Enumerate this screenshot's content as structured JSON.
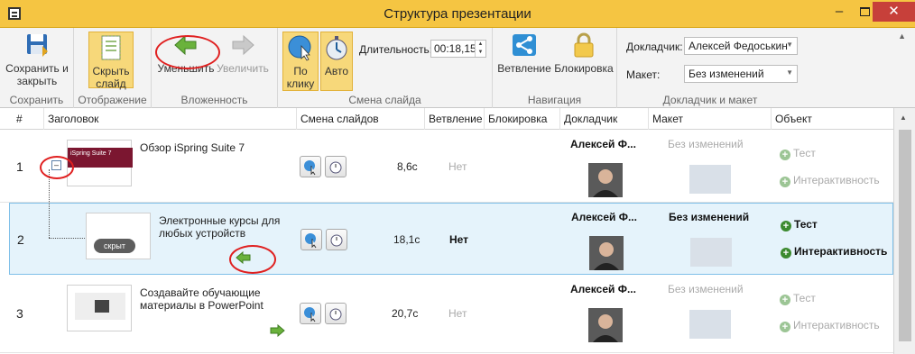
{
  "window": {
    "title": "Структура презентации",
    "min": "–",
    "max": "",
    "close": "✕"
  },
  "ribbon": {
    "save": {
      "label": "Сохранить и закрыть",
      "group": "Сохранить"
    },
    "display": {
      "label": "Скрыть слайд",
      "group": "Отображение"
    },
    "nesting": {
      "decrease": "Уменьшить",
      "increase": "Увеличить",
      "group": "Вложенность"
    },
    "transition": {
      "click": "По клику",
      "auto": "Авто",
      "duration_label": "Длительность:",
      "duration_value": "00:18,15",
      "group": "Смена слайда"
    },
    "navigation": {
      "branch": "Ветвление",
      "lock": "Блокировка",
      "group": "Навигация"
    },
    "presenter": {
      "presenter_label": "Докладчик:",
      "presenter_value": "Алексей Федоськин",
      "layout_label": "Макет:",
      "layout_value": "Без изменений",
      "group": "Докладчик и макет"
    }
  },
  "columns": [
    "#",
    "Заголовок",
    "Смена слайдов",
    "Ветвление",
    "Блокировка",
    "Докладчик",
    "Макет",
    "Объект"
  ],
  "rows": [
    {
      "num": "1",
      "title": "Обзор iSpring Suite 7",
      "thumb_text": "iSpring Suite 7",
      "time": "8,6с",
      "branch": "Нет",
      "presenter": "Алексей Ф...",
      "layout": "Без изменений",
      "obj1": "Тест",
      "obj2": "Интерактивность"
    },
    {
      "num": "2",
      "title": "Электронные курсы для любых устройств",
      "hidden_badge": "скрыт",
      "time": "18,1с",
      "branch": "Нет",
      "presenter": "Алексей Ф...",
      "layout": "Без изменений",
      "obj1": "Тест",
      "obj2": "Интерактивность"
    },
    {
      "num": "3",
      "title": "Создавайте обучающие материалы в PowerPoint",
      "time": "20,7с",
      "branch": "Нет",
      "presenter": "Алексей Ф...",
      "layout": "Без изменений",
      "obj1": "Тест",
      "obj2": "Интерактивность"
    }
  ],
  "colors": {
    "titlebar": "#f5c542",
    "selected_row": "#e5f3fb",
    "accent_green": "#6ab23c",
    "close": "#c7403a",
    "annotation": "#e02020"
  },
  "icons": [
    "app-icon",
    "save-icon",
    "hide-slide-icon",
    "decrease-arrow-icon",
    "increase-arrow-icon",
    "on-click-icon",
    "stopwatch-icon",
    "branch-icon",
    "lock-icon",
    "collapse-icon",
    "indent-left-icon",
    "indent-right-icon",
    "plus-icon"
  ]
}
